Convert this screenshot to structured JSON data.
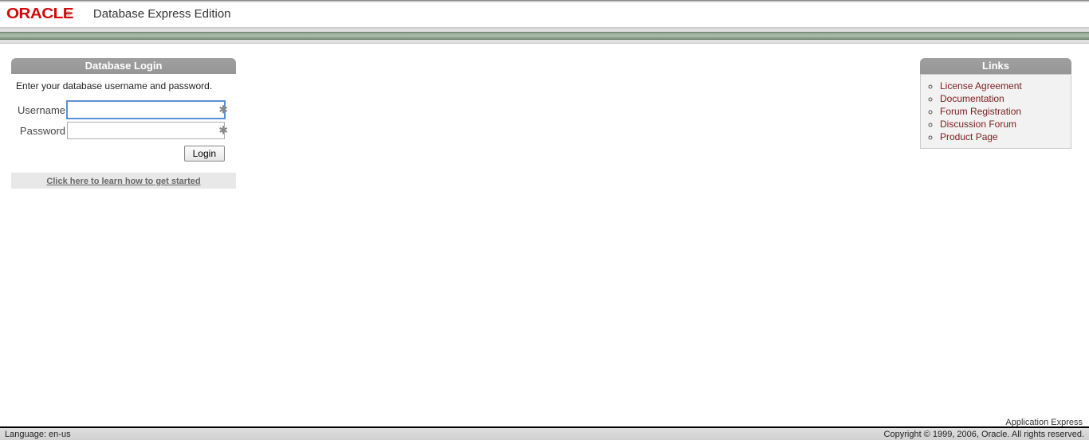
{
  "header": {
    "logo_text": "ORACLE",
    "product_title": "Database Express Edition"
  },
  "login": {
    "title": "Database Login",
    "instruction": "Enter your database username and password.",
    "username_label": "Username",
    "password_label": "Password",
    "username_value": "",
    "password_value": "",
    "login_button": "Login",
    "get_started": "Click here to learn how to get started"
  },
  "links": {
    "title": "Links",
    "items": [
      "License Agreement",
      "Documentation",
      "Forum Registration",
      "Discussion Forum",
      "Product Page"
    ]
  },
  "footer": {
    "app_name": "Application Express",
    "language": "Language: en-us",
    "copyright": "Copyright © 1999, 2006, Oracle. All rights reserved."
  }
}
